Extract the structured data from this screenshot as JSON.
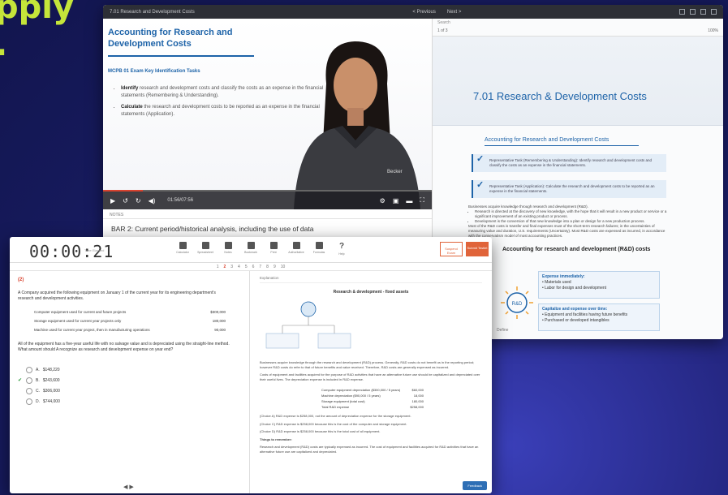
{
  "hero": {
    "line1": "pply",
    "line2": "."
  },
  "back_window": {
    "title": "7.01 Research and Development Costs",
    "nav_prev": "< Previous",
    "nav_next": "Next >",
    "video": {
      "slide_title": "Accounting for Research and Development Costs",
      "objectives_heading": "MCPB 01 Exam Key Identification Tasks",
      "bullets": [
        {
          "lead": "Identify",
          "text": " research and development costs and classify the costs as an expense in the financial statements (Remembering & Understanding)."
        },
        {
          "lead": "Calculate",
          "text": " the research and development costs to be reported as an expense in the financial statements (Application)."
        }
      ],
      "time": "01:56/07:56",
      "presenter_badge": "Becker"
    },
    "below_tabs": "NOTES",
    "bar_line": "BAR 2: Current period/historical analysis, including the use of data",
    "doc": {
      "toolbar": "Search",
      "page_label": "1 of 3",
      "zoom": "100%",
      "heading": "7.01 Research & Development Costs",
      "subheading": "Accounting for Research and Development Costs",
      "objectives": [
        "Representative Task (Remembering & Understanding): Identify research and development costs and classify the costs as an expense in the financial statements.",
        "Representative Task (Application): Calculate the research and development costs to be reported as an expense in the financial statements."
      ],
      "para": "Businesses acquire knowledge through research and development (R&D).",
      "items": [
        "Research is directed at the discovery of new knowledge, with the hope that it will result in a new product or service or a significant improvement of an existing product or process.",
        "Development is the conversion of that new knowledge into a plan or design for a new production process."
      ],
      "para2": "Most of the R&D costs is transfer and final expenses must of the short-term research failures; in the uncertainties of measuring value and duration, U.S. requirements (Uncertainty). Most R&D costs are expensed as incurred, in accordance with the conservatism model of most accounting practices.",
      "rd_title": "Accounting for research and development (R&D) costs",
      "rd_center": "R&D",
      "box1_title": "Expense immediately:",
      "box1_items": [
        "• Materials used",
        "• Labor for design and development"
      ],
      "box2_title": "Capitalize and expense over time:",
      "box2_items": [
        "• Equipment and facilities having future benefits",
        "• Purchased or developed intangibles"
      ],
      "footer_label": "Define"
    }
  },
  "front_window": {
    "timer": "00:00:21",
    "timer_label": "Time Elapsed",
    "tools": [
      "Calculator",
      "Spreadsheet",
      "Notes",
      "Bookmark",
      "Print",
      "Authoritative",
      "Formulas",
      "Help"
    ],
    "tools_help_glyph": "?",
    "suspend": "Suspend Exam",
    "submit": "Submit Testlet",
    "qnav": [
      "1",
      "2",
      "3",
      "4",
      "5",
      "6",
      "7",
      "8",
      "9",
      "10"
    ],
    "qnav_current": 2,
    "question": {
      "flag": "(2)",
      "text": "A Company acquired the following equipment on January 1 of the current year for its engineering department's research and development activities.",
      "rows": [
        {
          "label": "Computer equipment used for current and future projects",
          "amount": "$300,000"
        },
        {
          "label": "Storage equipment used for current year projects only",
          "amount": "180,000"
        },
        {
          "label": "Machine used for current year project, then in manufacturing operations",
          "amount": "90,000"
        }
      ],
      "ask": "All of the equipment has a five-year useful life with no salvage value and is depreciated using the straight-line method. What amount should A recognize as research and development expense on year end?",
      "choices": [
        {
          "letter": "A.",
          "value": "$148,220",
          "mark": ""
        },
        {
          "letter": "B.",
          "value": "$243,600",
          "mark": "✔"
        },
        {
          "letter": "C.",
          "value": "$306,000",
          "mark": ""
        },
        {
          "letter": "D.",
          "value": "$744,000",
          "mark": ""
        }
      ],
      "pager": "◀ ▶"
    },
    "explanation": {
      "header": "Explanation",
      "title": "Research & development - fixed assets",
      "text1": "Businesses acquire knowledge through the research and development (R&D) process. Generally, R&D costs do not benefit us in the reporting period; however R&D costs do refer to that of future benefits and value received. Therefore, R&D costs are generally expensed as incurred.",
      "text2": "Costs of equipment and facilities acquired for the purpose of R&D activities that have an alternative future use should be capitalized and depreciated over their useful lives. The depreciation expense is included in R&D expense.",
      "table": [
        {
          "label": "Computer equipment depreciation ($300,000 / 5 years)",
          "amount": "$60,000"
        },
        {
          "label": "Machine depreciation ($90,000 / 5 years)",
          "amount": "18,000"
        },
        {
          "label": "Storage equipment (total cost)",
          "amount": "180,000"
        },
        {
          "label": "Total R&D expense",
          "amount": "$258,000"
        }
      ],
      "choice_notes": [
        "(Choice A) R&D expense is $258,000, not the amount of depreciation expense for the storage equipment.",
        "(Choice C) R&D expense is $258,000 because this is the cost of the computer and storage equipment.",
        "(Choice D) R&D expense is $258,000 because this is the total cost of all equipment."
      ],
      "takeaway_title": "Things to remember:",
      "takeaway": "Research and development (R&D) costs are typically expensed as incurred. The cost of equipment and facilities acquired for R&D activities that have an alternative future use are capitalized and depreciated.",
      "feedback": "Feedback"
    }
  },
  "colors": {
    "accent": "#d9432f",
    "brand_blue": "#1d63a8",
    "headline": "#c5e53a",
    "bg": "#1c1f6b"
  }
}
